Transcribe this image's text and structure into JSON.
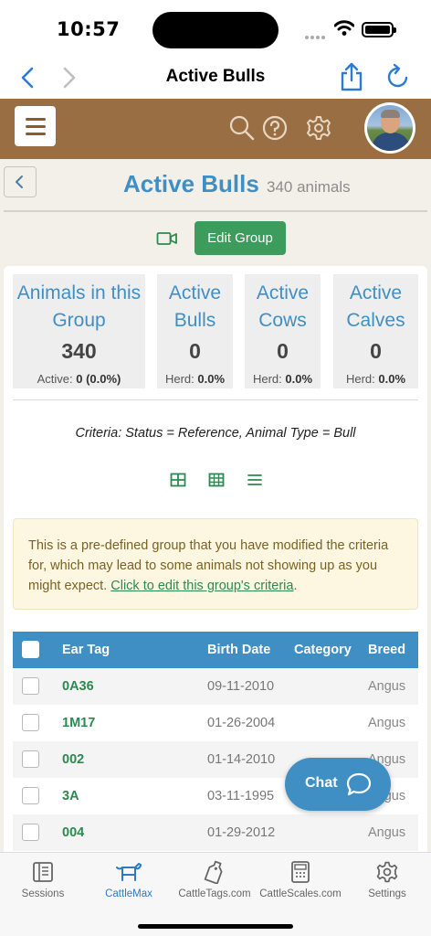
{
  "status_bar": {
    "time": "10:57"
  },
  "nav": {
    "title": "Active Bulls"
  },
  "page": {
    "title": "Active Bulls",
    "count": "340 animals",
    "edit_group_label": "Edit Group"
  },
  "stats": [
    {
      "label": "Animals in this Group",
      "value": "340",
      "sub_label": "Active:",
      "sub_value": "0 (0.0%)"
    },
    {
      "label": "Active Bulls",
      "value": "0",
      "sub_label": "Herd:",
      "sub_value": "0.0%"
    },
    {
      "label": "Active Cows",
      "value": "0",
      "sub_label": "Herd:",
      "sub_value": "0.0%"
    },
    {
      "label": "Active Calves",
      "value": "0",
      "sub_label": "Herd:",
      "sub_value": "0.0%"
    }
  ],
  "criteria": "Criteria: Status = Reference, Animal Type = Bull",
  "notice": {
    "text": "This is a pre-defined group that you have modified the criteria for, which may lead to some animals not showing up as you might expect. ",
    "link": "Click to edit this group's criteria",
    "end": "."
  },
  "table": {
    "headers": {
      "ear_tag": "Ear Tag",
      "birth_date": "Birth Date",
      "category": "Category",
      "breed": "Breed"
    },
    "rows": [
      {
        "ear_tag": "0A36",
        "birth_date": "09-11-2010",
        "category": "",
        "breed": "Angus"
      },
      {
        "ear_tag": "1M17",
        "birth_date": "01-26-2004",
        "category": "",
        "breed": "Angus"
      },
      {
        "ear_tag": "002",
        "birth_date": "01-14-2010",
        "category": "",
        "breed": "Angus"
      },
      {
        "ear_tag": "3A",
        "birth_date": "03-11-1995",
        "category": "",
        "breed": "Angus"
      },
      {
        "ear_tag": "004",
        "birth_date": "01-29-2012",
        "category": "",
        "breed": "Angus"
      }
    ]
  },
  "chat": {
    "label": "Chat"
  },
  "tabs": [
    {
      "label": "Sessions",
      "icon": "sessions-icon"
    },
    {
      "label": "CattleMax",
      "icon": "cattlemax-icon",
      "active": true
    },
    {
      "label": "CattleTags.com",
      "icon": "tag-icon"
    },
    {
      "label": "CattleScales.com",
      "icon": "scale-icon"
    },
    {
      "label": "Settings",
      "icon": "gear-icon"
    }
  ],
  "colors": {
    "brand_brown": "#9a6e43",
    "accent_blue": "#3f8fc4",
    "accent_green": "#3b9c5c",
    "notice_bg": "#fdf7e2"
  }
}
